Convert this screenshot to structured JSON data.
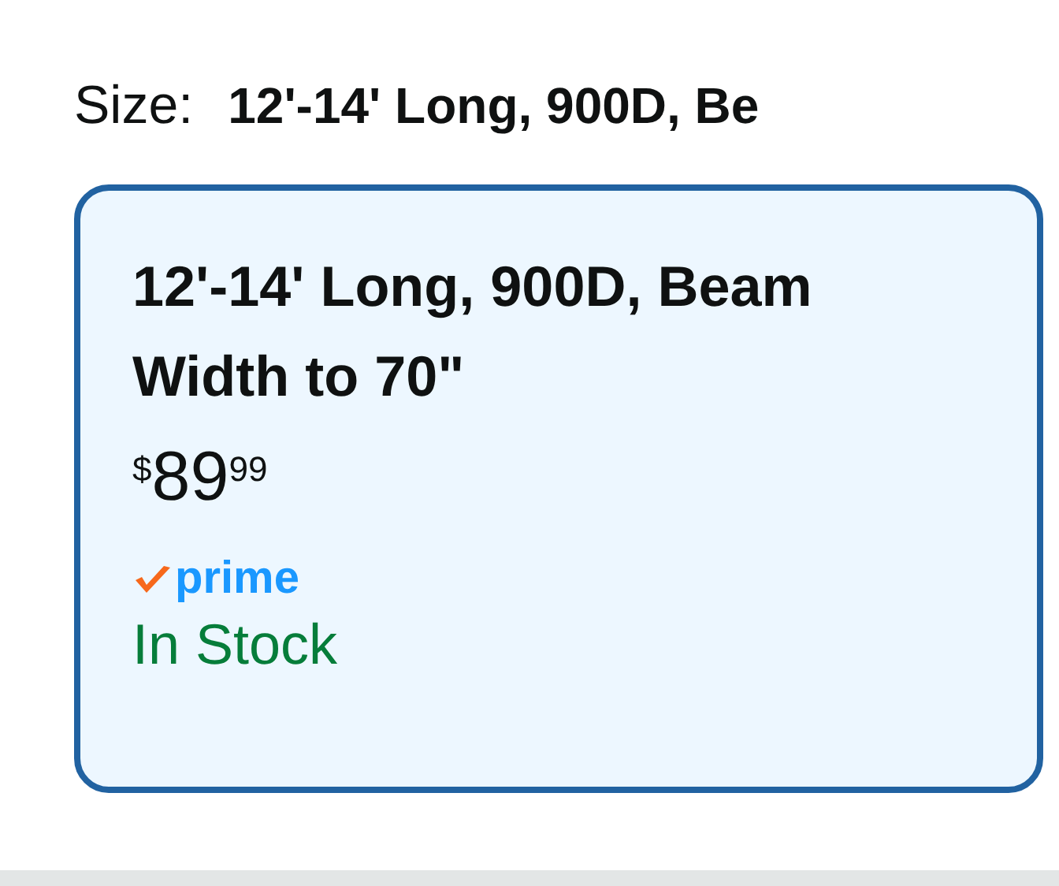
{
  "size_selector": {
    "label": "Size:",
    "value": "12'-14' Long, 900D, Be"
  },
  "options": [
    {
      "title": "12'-14' Long, 900D, Beam Width to 70\"",
      "price": {
        "symbol": "$",
        "whole": "89",
        "fraction": "99"
      },
      "badge": "prime",
      "availability": "In Stock",
      "selected": true
    }
  ]
}
